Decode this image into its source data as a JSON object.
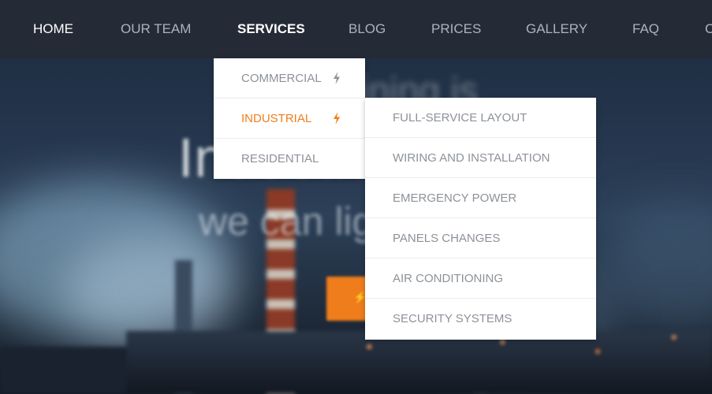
{
  "hero": {
    "headline": "Industrial is...",
    "subline": "we can light",
    "top_text": "aining is"
  },
  "nav": {
    "items": [
      {
        "label": "HOME"
      },
      {
        "label": "OUR TEAM"
      },
      {
        "label": "SERVICES"
      },
      {
        "label": "BLOG"
      },
      {
        "label": "PRICES"
      },
      {
        "label": "GALLERY"
      },
      {
        "label": "FAQ"
      },
      {
        "label": "C"
      }
    ]
  },
  "services_menu": {
    "items": [
      {
        "label": "COMMERCIAL",
        "icon": "lightning-bolt-icon"
      },
      {
        "label": "INDUSTRIAL",
        "icon": "lightning-bolt-icon"
      },
      {
        "label": "RESIDENTIAL"
      }
    ]
  },
  "industrial_submenu": {
    "items": [
      {
        "label": "FULL-SERVICE LAYOUT"
      },
      {
        "label": "WIRING AND INSTALLATION"
      },
      {
        "label": "EMERGENCY POWER"
      },
      {
        "label": "PANELS CHANGES"
      },
      {
        "label": "AIR CONDITIONING"
      },
      {
        "label": "SECURITY SYSTEMS"
      }
    ]
  },
  "colors": {
    "accent": "#f07d1b",
    "navbar": "#252b36",
    "menu_text": "#8d9299"
  }
}
